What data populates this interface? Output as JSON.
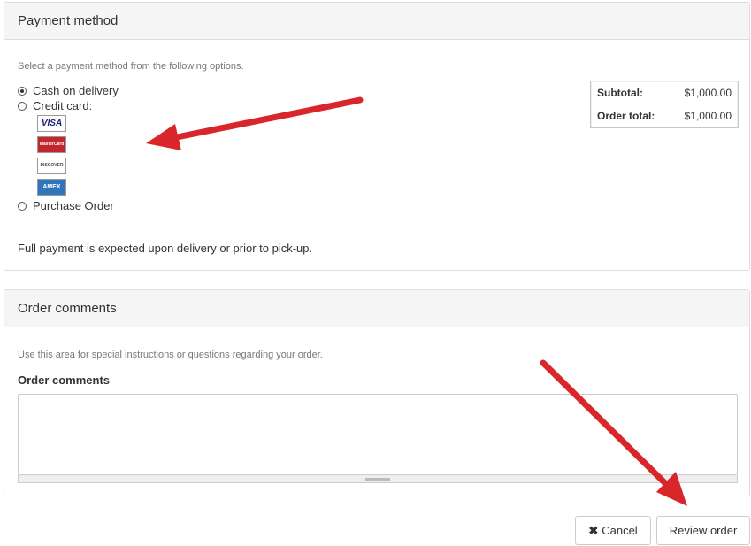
{
  "payment": {
    "title": "Payment method",
    "help": "Select a payment method from the following options.",
    "options": [
      {
        "label": "Cash on delivery",
        "checked": true
      },
      {
        "label": "Credit card:",
        "checked": false
      },
      {
        "label": "Purchase Order",
        "checked": false
      }
    ],
    "cards": [
      {
        "name": "visa-icon",
        "text": "VISA",
        "color": "#1a1f71"
      },
      {
        "name": "mastercard-icon",
        "text": "MasterCard",
        "color": "#eb001b"
      },
      {
        "name": "discover-icon",
        "text": "DISCOVER",
        "color": "#f68121"
      },
      {
        "name": "amex-icon",
        "text": "AMEX",
        "color": "#2e77bc"
      }
    ],
    "note": "Full payment is expected upon delivery or prior to pick-up.",
    "totals": {
      "subtotal_label": "Subtotal:",
      "subtotal_value": "$1,000.00",
      "order_total_label": "Order total:",
      "order_total_value": "$1,000.00"
    }
  },
  "comments": {
    "title": "Order comments",
    "help": "Use this area for special instructions or questions regarding your order.",
    "field_label": "Order comments",
    "value": ""
  },
  "actions": {
    "cancel_label": "Cancel",
    "review_label": "Review order"
  },
  "colors": {
    "annotation_arrow": "#d9262b",
    "panel_heading_bg": "#f5f5f5",
    "border": "#dddddd"
  }
}
